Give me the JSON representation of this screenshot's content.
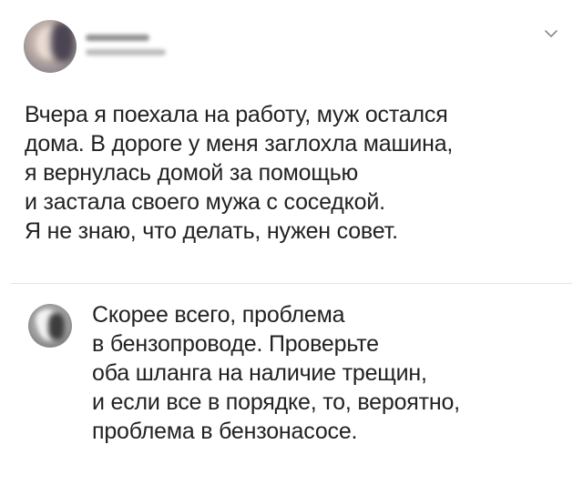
{
  "post": {
    "author_name": "",
    "author_handle": "",
    "menu_icon": "chevron-down-icon",
    "lines": [
      "Вчера я поехала на работу, муж остался",
      "дома. В дороге у меня заглохла машина,",
      "я вернулась домой за помощью",
      "и застала своего мужа с соседкой.",
      "Я не знаю, что делать, нужен совет."
    ]
  },
  "reply": {
    "lines": [
      "Скорее всего, проблема",
      "в бензопроводе. Проверьте",
      "оба шланга на наличие трещин,",
      "и если все в порядке, то, вероятно,",
      "проблема в бензонасосе."
    ]
  },
  "colors": {
    "text": "#222222",
    "divider": "#e4e4e4",
    "background": "#ffffff"
  }
}
